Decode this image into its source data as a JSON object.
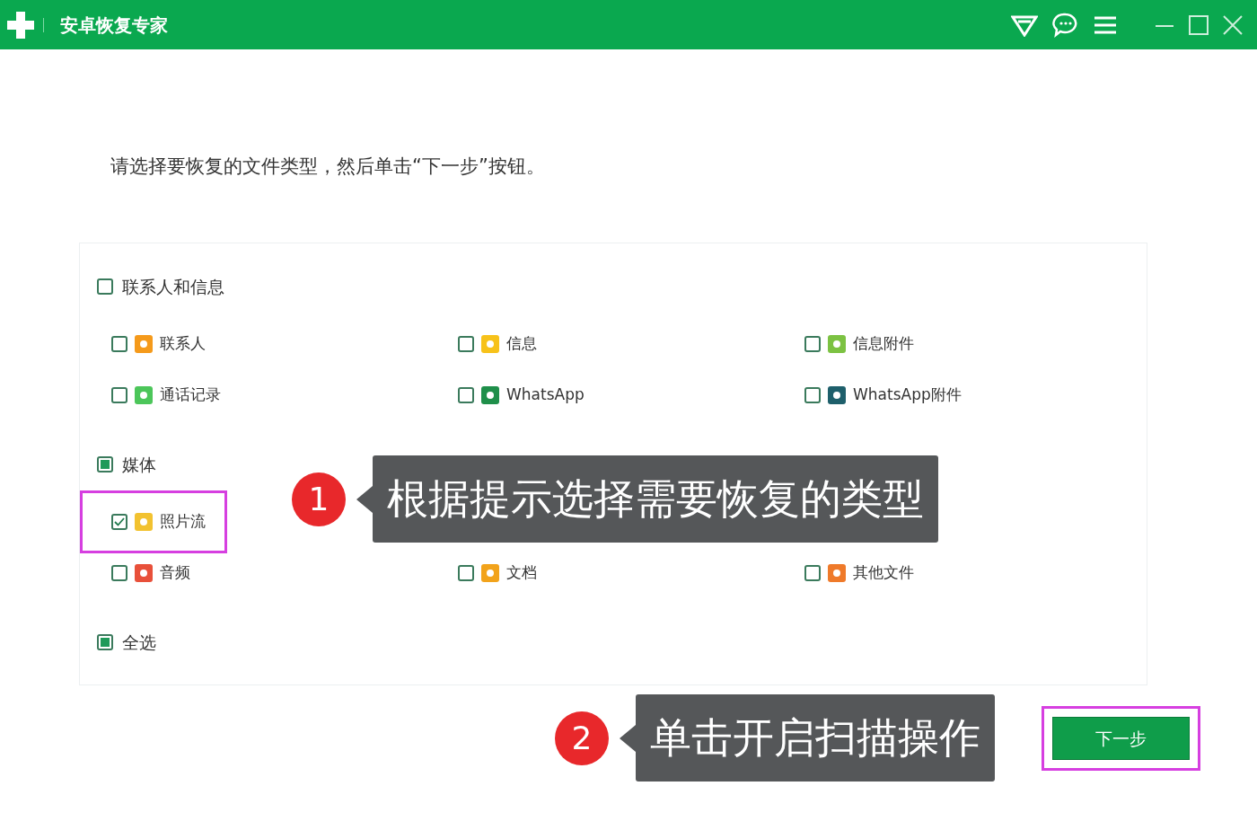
{
  "window": {
    "title": "安卓恢复专家"
  },
  "instruction": "请选择要恢复的文件类型，然后单击“下一步”按钮。",
  "groups": [
    {
      "label": "联系人和信息",
      "checked": false,
      "partial": false,
      "rows": [
        [
          {
            "label": "联系人",
            "checked": false,
            "highlighted": false,
            "color": "#f59a1b"
          },
          {
            "label": "信息",
            "checked": false,
            "highlighted": false,
            "color": "#f7c21a"
          },
          {
            "label": "信息附件",
            "checked": false,
            "highlighted": false,
            "color": "#7cc242"
          }
        ],
        [
          {
            "label": "通话记录",
            "checked": false,
            "highlighted": false,
            "color": "#4cc65a"
          },
          {
            "label": "WhatsApp",
            "checked": false,
            "highlighted": false,
            "color": "#1f8f4a"
          },
          {
            "label": "WhatsApp附件",
            "checked": false,
            "highlighted": false,
            "color": "#1e5f6b"
          }
        ]
      ]
    },
    {
      "label": "媒体",
      "checked": false,
      "partial": true,
      "rows": [
        [
          {
            "label": "照片流",
            "checked": true,
            "highlighted": true,
            "color": "#f2c230"
          }
        ],
        [
          {
            "label": "音频",
            "checked": false,
            "highlighted": false,
            "color": "#e8503a"
          },
          {
            "label": "文档",
            "checked": false,
            "highlighted": false,
            "color": "#f2a31b"
          },
          {
            "label": "其他文件",
            "checked": false,
            "highlighted": false,
            "color": "#ef7a2a"
          }
        ]
      ]
    }
  ],
  "select_all": {
    "label": "全选",
    "checked": false,
    "partial": true
  },
  "callouts": [
    {
      "number": "1",
      "text": "根据提示选择需要恢复的类型"
    },
    {
      "number": "2",
      "text": "单击开启扫描操作"
    }
  ],
  "next_button": {
    "label": "下一步",
    "highlighted": true
  }
}
